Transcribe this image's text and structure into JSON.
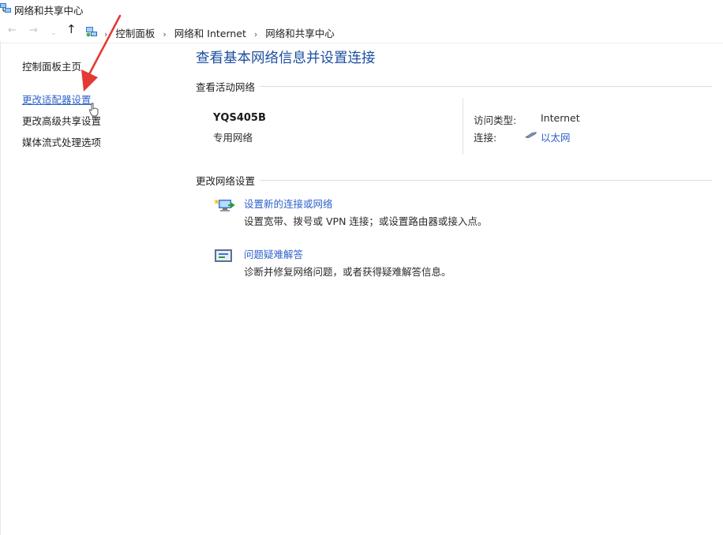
{
  "window": {
    "title": "网络和共享中心"
  },
  "addressbar": {
    "back_glyph": "←",
    "forward_glyph": "→",
    "history_glyph": "⌄",
    "up_glyph": "↑",
    "separator_glyph": "›",
    "breadcrumbs": [
      "控制面板",
      "网络和 Internet",
      "网络和共享中心"
    ]
  },
  "sidebar": {
    "home": "控制面板主页",
    "links": [
      {
        "label": "更改适配器设置",
        "active": true
      },
      {
        "label": "更改高级共享设置",
        "active": false
      },
      {
        "label": "媒体流式处理选项",
        "active": false
      }
    ]
  },
  "main": {
    "title": "查看基本网络信息并设置连接",
    "active_section": "查看活动网络",
    "network": {
      "name": "YQS405B",
      "category": "专用网络",
      "access_label": "访问类型:",
      "access_value": "Internet",
      "connection_label": "连接:",
      "connection_value": "以太网"
    },
    "change_section": "更改网络设置",
    "tasks": [
      {
        "icon": "new-connection-icon",
        "link": "设置新的连接或网络",
        "desc": "设置宽带、拨号或 VPN 连接；或设置路由器或接入点。"
      },
      {
        "icon": "troubleshoot-icon",
        "link": "问题疑难解答",
        "desc": "诊断并修复网络问题，或者获得疑难解答信息。"
      }
    ]
  },
  "colors": {
    "link": "#2e62c9",
    "title": "#1e4fa0",
    "annotation_arrow": "#e53935"
  }
}
